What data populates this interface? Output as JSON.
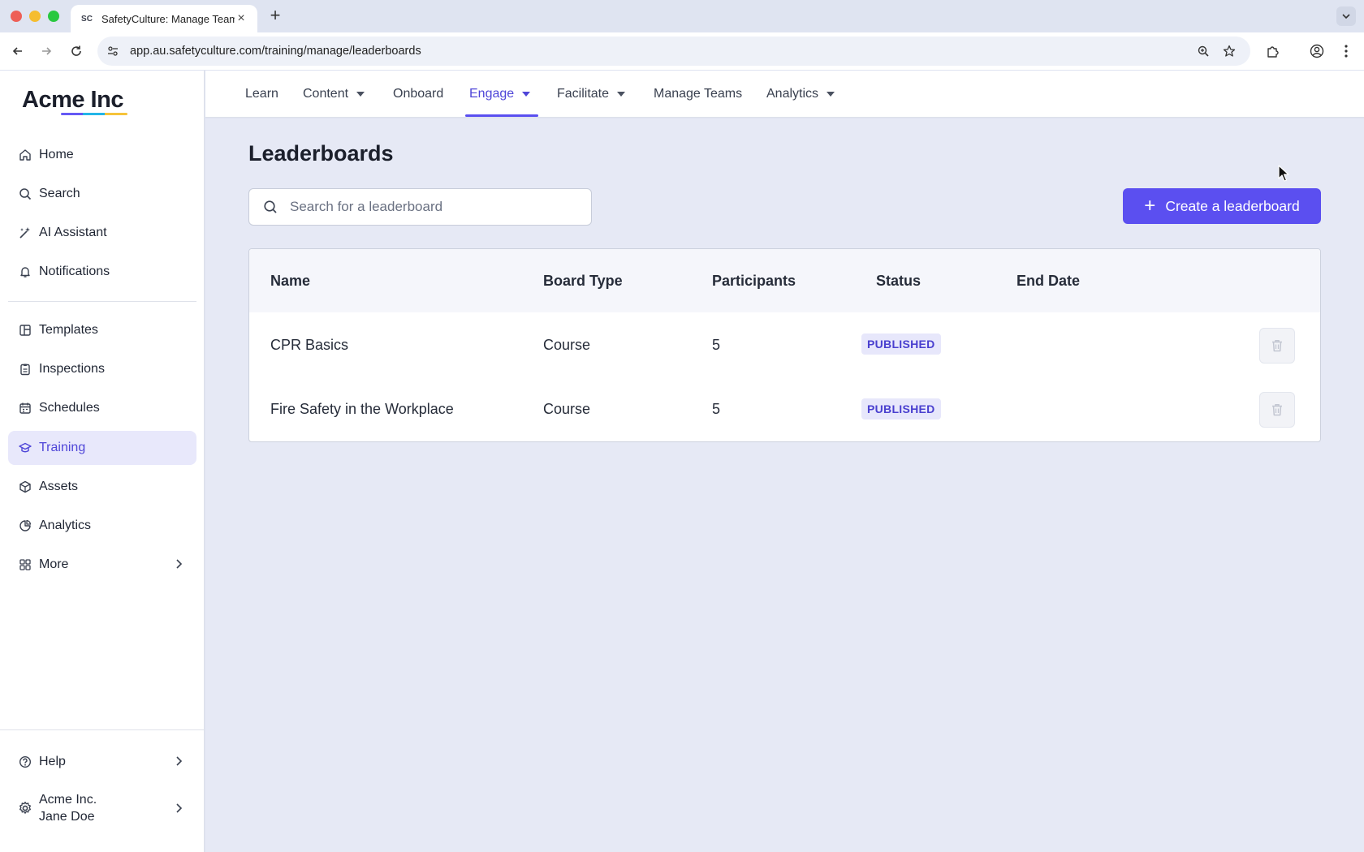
{
  "browser": {
    "tab_title": "SafetyCulture: Manage Teams",
    "url": "app.au.safetyculture.com/training/manage/leaderboards"
  },
  "sidebar": {
    "logo": "Acme Inc",
    "items": [
      {
        "label": "Home",
        "icon": "home-icon"
      },
      {
        "label": "Search",
        "icon": "search-icon"
      },
      {
        "label": "AI Assistant",
        "icon": "sparkle-icon"
      },
      {
        "label": "Notifications",
        "icon": "bell-icon"
      },
      {
        "label": "Templates",
        "icon": "templates-icon"
      },
      {
        "label": "Inspections",
        "icon": "clipboard-icon"
      },
      {
        "label": "Schedules",
        "icon": "calendar-icon"
      },
      {
        "label": "Training",
        "icon": "graduation-cap-icon",
        "active": true
      },
      {
        "label": "Assets",
        "icon": "cube-icon"
      },
      {
        "label": "Analytics",
        "icon": "pie-chart-icon"
      },
      {
        "label": "More",
        "icon": "grid-icon"
      }
    ],
    "help": "Help",
    "org": "Acme Inc.",
    "user": "Jane Doe"
  },
  "topnav": {
    "items": [
      {
        "label": "Learn"
      },
      {
        "label": "Content"
      },
      {
        "label": "Onboard"
      },
      {
        "label": "Engage",
        "active": true
      },
      {
        "label": "Facilitate"
      },
      {
        "label": "Manage Teams"
      },
      {
        "label": "Analytics"
      }
    ]
  },
  "page": {
    "title": "Leaderboards",
    "search_placeholder": "Search for a leaderboard",
    "create_label": "Create a leaderboard"
  },
  "table": {
    "columns": [
      "Name",
      "Board Type",
      "Participants",
      "Status",
      "End Date"
    ],
    "rows": [
      {
        "name": "CPR Basics",
        "board_type": "Course",
        "participants": "5",
        "status": "PUBLISHED",
        "end_date": ""
      },
      {
        "name": "Fire Safety in the Workplace",
        "board_type": "Course",
        "participants": "5",
        "status": "PUBLISHED",
        "end_date": ""
      }
    ]
  },
  "colors": {
    "accent": "#5b4ff0",
    "active_text": "#4f46d8",
    "badge_bg": "#e7e7fb",
    "page_bg": "#e6e9f5"
  }
}
